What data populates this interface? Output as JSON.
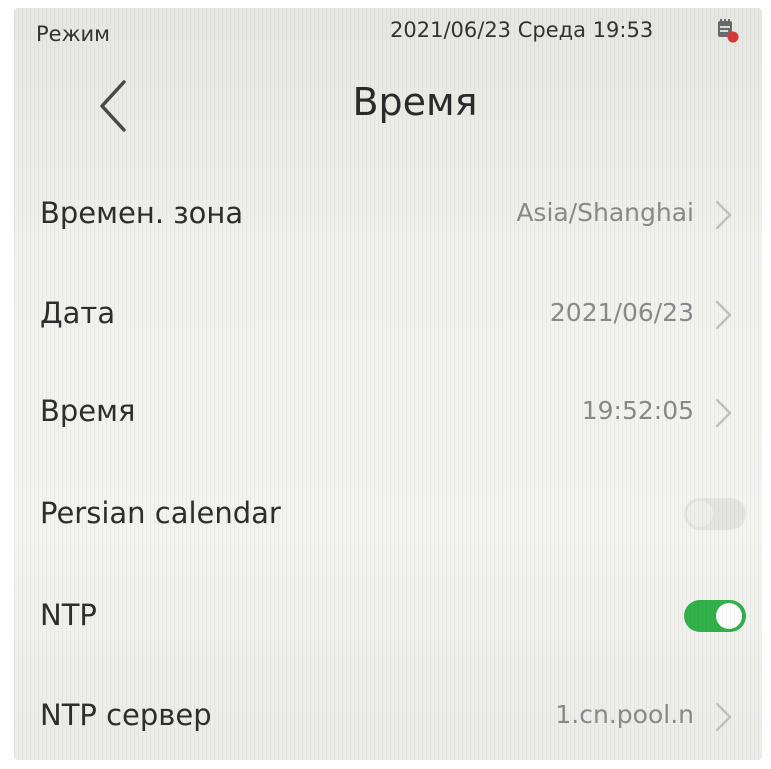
{
  "status_bar": {
    "mode": "Режим",
    "datetime": "2021/06/23 Среда 19:53",
    "icon": "notification-icon"
  },
  "header": {
    "title": "Время",
    "back_icon": "chevron-left-icon"
  },
  "settings": {
    "timezone": {
      "label": "Времен. зона",
      "value": "Asia/Shanghai"
    },
    "date": {
      "label": "Дата",
      "value": "2021/06/23"
    },
    "time": {
      "label": "Время",
      "value": "19:52:05"
    },
    "persian_calendar": {
      "label": "Persian calendar",
      "enabled": false
    },
    "ntp": {
      "label": "NTP",
      "enabled": true
    },
    "ntp_server": {
      "label": "NTP сервер",
      "value": "1.cn.pool.n"
    }
  },
  "colors": {
    "toggle_on": "#32b04a",
    "toggle_off": "#e4e4e1",
    "value_text": "#8a8a8a",
    "chevron": "#c2c2c2",
    "status_icon_badge": "#d23a3a"
  }
}
